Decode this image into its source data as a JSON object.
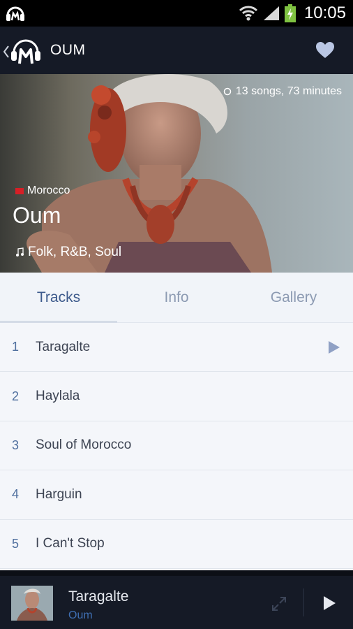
{
  "status_bar": {
    "time": "10:05"
  },
  "app_bar": {
    "title": "OUM"
  },
  "artist": {
    "stats": "13 songs, 73 minutes",
    "country": "Morocco",
    "name": "Oum",
    "genres": "Folk, R&B, Soul"
  },
  "tabs": [
    {
      "label": "Tracks",
      "active": true
    },
    {
      "label": "Info",
      "active": false
    },
    {
      "label": "Gallery",
      "active": false
    }
  ],
  "tracks": [
    {
      "number": "1",
      "title": "Taragalte"
    },
    {
      "number": "2",
      "title": "Haylala"
    },
    {
      "number": "3",
      "title": "Soul of Morocco"
    },
    {
      "number": "4",
      "title": "Harguin"
    },
    {
      "number": "5",
      "title": "I Can't Stop"
    }
  ],
  "now_playing": {
    "title": "Taragalte",
    "artist": "Oum"
  },
  "colors": {
    "accent": "#3d5a8c",
    "app_bar": "#151a26",
    "list_bg": "#f4f6fa"
  }
}
